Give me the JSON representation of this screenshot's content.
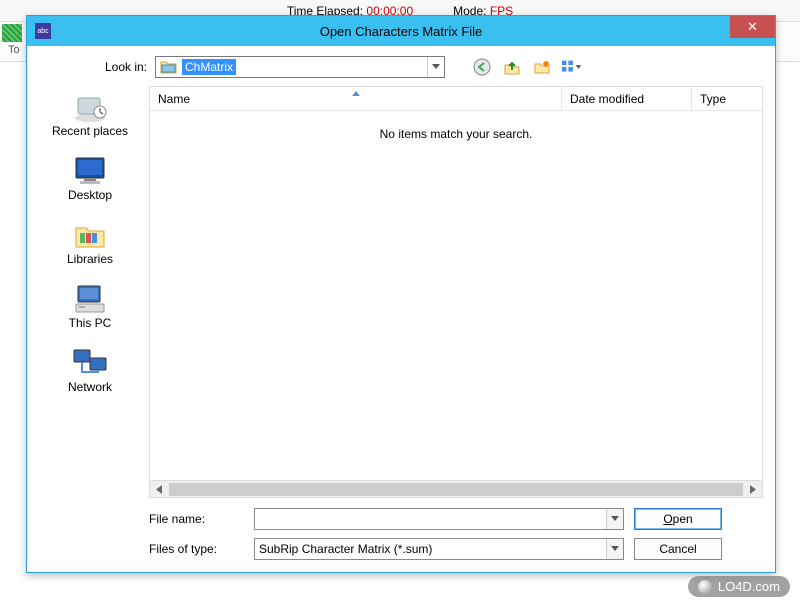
{
  "bg": {
    "elapsed_label": "Time Elapsed:",
    "elapsed_value": "00:00:00",
    "mode_label": "Mode:",
    "mode_value": "FPS",
    "small_label": "To"
  },
  "dialog": {
    "title": "Open Characters Matrix File",
    "close_glyph": "✕",
    "lookin_label": "Look in:",
    "lookin_value": "ChMatrix",
    "toolbar_icons": {
      "back": "back-icon",
      "up": "up-one-level-icon",
      "newfolder": "new-folder-icon",
      "view": "view-menu-icon"
    },
    "places": [
      {
        "key": "recent",
        "label": "Recent places"
      },
      {
        "key": "desktop",
        "label": "Desktop"
      },
      {
        "key": "libraries",
        "label": "Libraries"
      },
      {
        "key": "thispc",
        "label": "This PC"
      },
      {
        "key": "network",
        "label": "Network"
      }
    ],
    "columns": {
      "name": "Name",
      "date": "Date modified",
      "type": "Type"
    },
    "empty_message": "No items match your search.",
    "filename_label": "File name:",
    "filename_value": "",
    "filetype_label": "Files of type:",
    "filetype_value": "SubRip Character Matrix (*.sum)",
    "open_label": "Open",
    "cancel_label": "Cancel"
  },
  "watermark": "LO4D.com"
}
